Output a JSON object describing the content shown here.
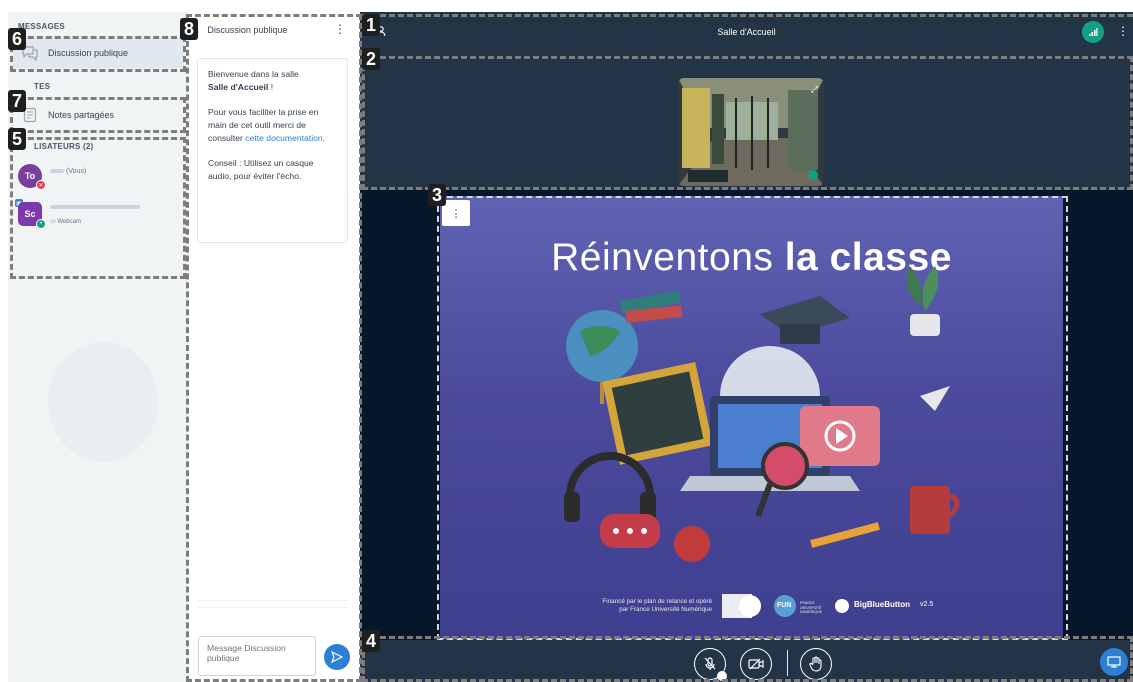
{
  "sidebar": {
    "messages_title": "MESSAGES",
    "public_chat_label": "Discussion publique",
    "notes_title": "TES",
    "shared_notes_label": "Notes partagées",
    "users_title": "LISATEURS (2)",
    "users": [
      {
        "initials": "To",
        "name_suffix": "(Vous)",
        "color": "#7a3e9d"
      },
      {
        "initials": "Sc",
        "sub": "Webcam",
        "color": "#7c3aad"
      }
    ]
  },
  "chat": {
    "title": "Discussion publique",
    "welcome_line1": "Bienvenue dans la salle",
    "welcome_room": "Salle d'Accueil",
    "welcome_bang": " !",
    "help_text": "Pour vous faciliter la prise en main de cet outil merci de consulter",
    "help_link": "cette documentation",
    "help_end": ".",
    "advice_bold": "Conseil : Utilisez un casque audio, pour éviter l'écho.",
    "input_placeholder": "Message Discussion publique"
  },
  "meeting": {
    "title": "Salle d'Accueil"
  },
  "slide": {
    "title_light": "Réinventons ",
    "title_bold": "la classe",
    "footer_funding": "Financé par le plan de relance et opéré par France Université Numérique",
    "logo_fun": "FUN",
    "logo_fun_label": "FRANCE UNIVERSITÉ NUMÉRIQUE",
    "bbb_label": "BigBlueButton",
    "bbb_version": "v2.5"
  },
  "callouts": [
    "1",
    "2",
    "3",
    "4",
    "5",
    "6",
    "7",
    "8"
  ],
  "colors": {
    "accent": "#2d7fd3",
    "topbar": "#243447",
    "stage": "#06172a",
    "connection": "#14a087"
  }
}
